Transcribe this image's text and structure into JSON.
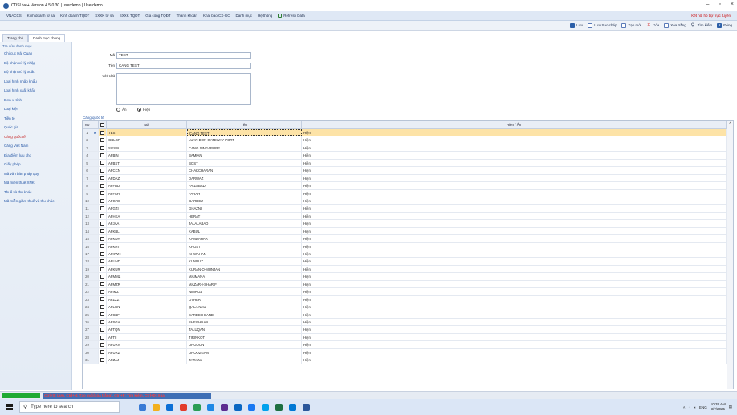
{
  "window": {
    "title": "CDSLive+ Version 4.5.0.30 | userdemo | Userdemo"
  },
  "menu": {
    "items": [
      "VNACCS",
      "Kinh doanh tử sa",
      "Kinh doanh TQĐT",
      "SXXK từ sa",
      "SXXK TQĐT",
      "Gia công TQĐT",
      "Thanh khoản",
      "Khai báo CX-GC",
      "Danh mục",
      "Hệ thống",
      "Refresh Data"
    ],
    "support": "Kết nối hỗ trợ trực tuyến"
  },
  "toolbar": {
    "save": "Lưu",
    "save_copy": "Lưu Sao chép",
    "new": "Tạo mới",
    "delete": "Xóa",
    "clear": "Xóa trắng",
    "find": "Tìm kiếm",
    "close": "Đóng"
  },
  "tabs": [
    "Trang chủ",
    "Danh mục chung"
  ],
  "sidebar": {
    "header": "Tra cứu danh mục",
    "items": [
      "Chi cục Hải Quan",
      "Bộ phận xử lý nhập",
      "Bộ phận xử lý xuất",
      "Loại hình nhập khẩu",
      "Loại hình xuất khẩu",
      "Đơn vị tính",
      "Loại kiện",
      "Tiền tệ",
      "Quốc gia",
      "Cảng quốc tế",
      "Cảng Việt Nam",
      "Địa điểm lưu kho",
      "Giấy phép",
      "Mã văn bản pháp quy",
      "Mã miễn thuế XNK",
      "Thuế và thu khác",
      "Mã miễn giảm thuế và thu khác"
    ],
    "active_index": 9
  },
  "form": {
    "ma_label": "Mã",
    "ma_value": "TEST",
    "ten_label": "Tên",
    "ten_value": "CANG TEST",
    "ghichu_label": "Ghi chú",
    "radio_an": "Ẩn",
    "radio_hien": "Hiện",
    "radio_selected": "Hiện"
  },
  "grid": {
    "caption": "Cảng quốc tế",
    "headers": {
      "no": "No",
      "ma": "Mã",
      "ten": "Tên",
      "hien": "Hiện / Ẩn"
    },
    "rows": [
      [
        "1",
        "TEST",
        "CANG TEST",
        "Hiện"
      ],
      [
        "2",
        "GBLGP",
        "LUAN DON GATEWAY PORT",
        "Hiện"
      ],
      [
        "3",
        "SGSIN",
        "CANG SINGAPORE",
        "Hiện"
      ],
      [
        "4",
        "AFBIN",
        "BAMIAN",
        "Hiện"
      ],
      [
        "5",
        "AFBST",
        "BOST",
        "Hiện"
      ],
      [
        "6",
        "AFCCN",
        "CHAKCHARAN",
        "Hiện"
      ],
      [
        "7",
        "AFDAZ",
        "DARWAZ",
        "Hiện"
      ],
      [
        "8",
        "AFFBD",
        "FAIZABAD",
        "Hiện"
      ],
      [
        "9",
        "AFFAH",
        "FARAH",
        "Hiện"
      ],
      [
        "10",
        "AFGRG",
        "GARDEZ",
        "Hiện"
      ],
      [
        "11",
        "AFGZI",
        "GHAZNI",
        "Hiện"
      ],
      [
        "12",
        "AFHEA",
        "HERAT",
        "Hiện"
      ],
      [
        "13",
        "AFJAA",
        "JALALABAD",
        "Hiện"
      ],
      [
        "14",
        "AFKBL",
        "KABUL",
        "Hiện"
      ],
      [
        "15",
        "AFKDH",
        "KANDAHAR",
        "Hiện"
      ],
      [
        "16",
        "AFKHT",
        "KHOST",
        "Hiện"
      ],
      [
        "17",
        "AFKWH",
        "KHWAHAN",
        "Hiện"
      ],
      [
        "18",
        "AFUND",
        "KUNDUZ",
        "Hiện"
      ],
      [
        "19",
        "AFKUR",
        "KURAN-O-MUNJAN",
        "Hiện"
      ],
      [
        "20",
        "AFMMZ",
        "MAIMANA",
        "Hiện"
      ],
      [
        "21",
        "AFMZR",
        "MAZAR-I-SHARIF",
        "Hiện"
      ],
      [
        "22",
        "AFIMZ",
        "NIMROZ",
        "Hiện"
      ],
      [
        "23",
        "AFZZZ",
        "OTHER",
        "Hiện"
      ],
      [
        "24",
        "AFLGN",
        "QALA NAU",
        "Hiện"
      ],
      [
        "25",
        "AFSBF",
        "SARDEH BAND",
        "Hiện"
      ],
      [
        "26",
        "AFSGA",
        "SHEGHNAN",
        "Hiện"
      ],
      [
        "27",
        "AFTQN",
        "TALUQAN",
        "Hiện"
      ],
      [
        "28",
        "AFTII",
        "TIRINKOT",
        "Hiện"
      ],
      [
        "29",
        "AFURN",
        "URGOON",
        "Hiện"
      ],
      [
        "30",
        "AFURZ",
        "UROOZGAN",
        "Hiện"
      ],
      [
        "31",
        "AFZAJ",
        "ZARANJ",
        "Hiện"
      ]
    ]
  },
  "status": {
    "hint": "Ctrl+S: Lưu, Ctrl+N: Tạo mới(xóa trắng), Ctrl+F: Tìm kiếm, Ctrl+D: Xóa"
  },
  "taskbar": {
    "search_placeholder": "Type here to search",
    "lang": "ENG",
    "time": "10:39 AM",
    "date": "3/7/2025"
  }
}
